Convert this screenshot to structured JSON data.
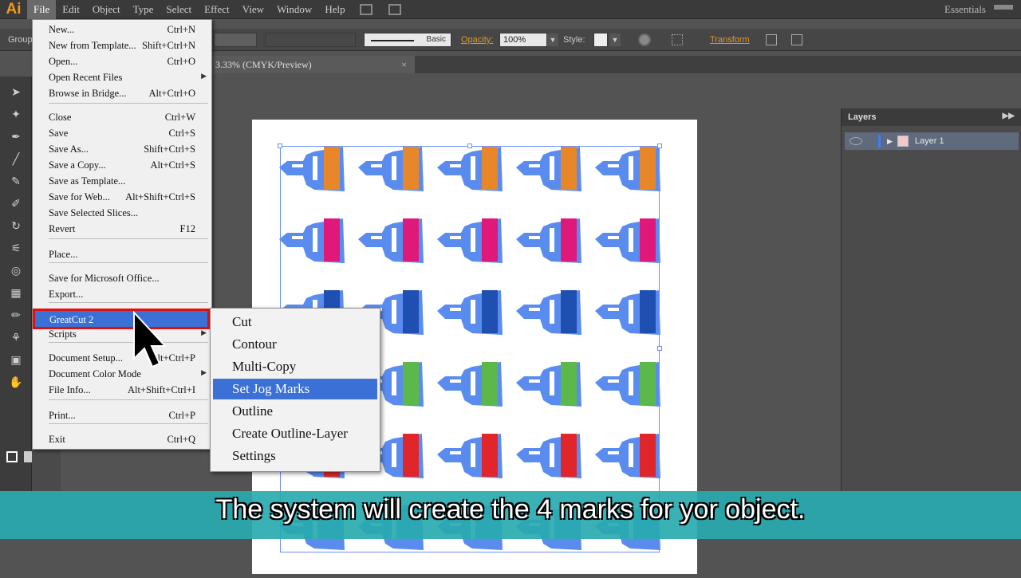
{
  "app": {
    "logo": "Ai",
    "workspace": "Essentials"
  },
  "menubar": {
    "items": [
      "File",
      "Edit",
      "Object",
      "Type",
      "Select",
      "Effect",
      "View",
      "Window",
      "Help"
    ]
  },
  "controlbar": {
    "group_label": "Group",
    "stroke_style": "Basic",
    "opacity_label": "Opacity:",
    "opacity_value": "100%",
    "style_label": "Style:",
    "transform_label": "Transform"
  },
  "document_tab": {
    "title": "3.33% (CMYK/Preview)",
    "close": "×"
  },
  "layers_panel": {
    "title": "Layers",
    "layer_name": "Layer 1"
  },
  "file_menu": {
    "items": [
      {
        "label": "New...",
        "shortcut": "Ctrl+N"
      },
      {
        "label": "New from Template...",
        "shortcut": "Shift+Ctrl+N"
      },
      {
        "label": "Open...",
        "shortcut": "Ctrl+O"
      },
      {
        "label": "Open Recent Files",
        "shortcut": ""
      },
      {
        "label": "Browse in Bridge...",
        "shortcut": "Alt+Ctrl+O"
      },
      {
        "label": "Close",
        "shortcut": "Ctrl+W"
      },
      {
        "label": "Save",
        "shortcut": "Ctrl+S"
      },
      {
        "label": "Save As...",
        "shortcut": "Shift+Ctrl+S"
      },
      {
        "label": "Save a Copy...",
        "shortcut": "Alt+Ctrl+S"
      },
      {
        "label": "Save as Template...",
        "shortcut": ""
      },
      {
        "label": "Save for Web...",
        "shortcut": "Alt+Shift+Ctrl+S"
      },
      {
        "label": "Save Selected Slices...",
        "shortcut": ""
      },
      {
        "label": "Revert",
        "shortcut": "F12"
      },
      {
        "label": "Place...",
        "shortcut": ""
      },
      {
        "label": "Save for Microsoft Office...",
        "shortcut": ""
      },
      {
        "label": "Export...",
        "shortcut": ""
      },
      {
        "label": "GreatCut 2",
        "shortcut": ""
      },
      {
        "label": "Scripts",
        "shortcut": ""
      },
      {
        "label": "Document Setup...",
        "shortcut": "Alt+Ctrl+P"
      },
      {
        "label": "Document Color Mode",
        "shortcut": ""
      },
      {
        "label": "File Info...",
        "shortcut": "Alt+Shift+Ctrl+I"
      },
      {
        "label": "Print...",
        "shortcut": "Ctrl+P"
      },
      {
        "label": "Exit",
        "shortcut": "Ctrl+Q"
      }
    ]
  },
  "submenu": {
    "items": [
      "Cut",
      "Contour",
      "Multi-Copy",
      "Set Jog Marks",
      "Outline",
      "Create Outline-Layer",
      "Settings"
    ],
    "active": "Set Jog Marks"
  },
  "caption": "The system will create the 4 marks for yor object.",
  "colors": {
    "row_colors": [
      "#e8862a",
      "#e0187a",
      "#1f4fb0",
      "#5cb84a",
      "#e0262a",
      "#5a8cf0"
    ],
    "icon_blue": "#5a8cf0",
    "accent": "#3b70d6"
  }
}
